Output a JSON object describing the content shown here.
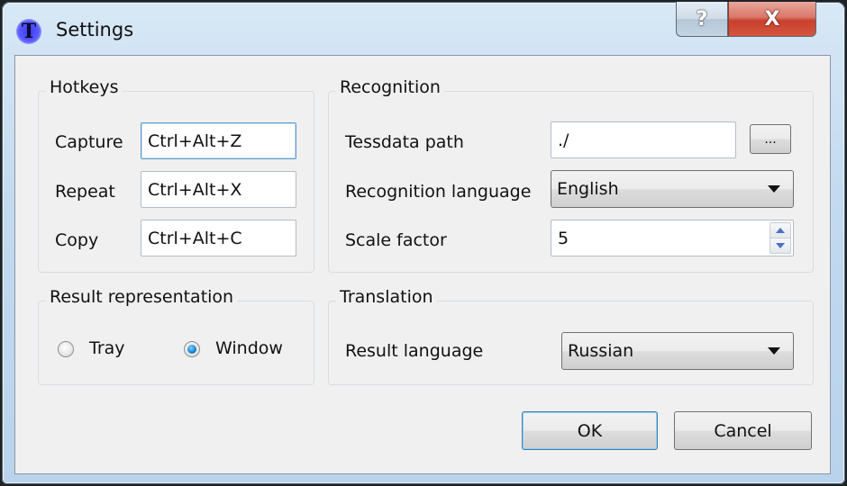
{
  "window": {
    "title": "Settings",
    "app_icon_glyph": "T",
    "help_button_glyph": "?",
    "close_button_glyph": "X"
  },
  "hotkeys": {
    "title": "Hotkeys",
    "rows": [
      {
        "label": "Capture",
        "value": "Ctrl+Alt+Z"
      },
      {
        "label": "Repeat",
        "value": "Ctrl+Alt+X"
      },
      {
        "label": "Copy",
        "value": "Ctrl+Alt+C"
      }
    ]
  },
  "recognition": {
    "title": "Recognition",
    "tessdata_label": "Tessdata path",
    "tessdata_value": "./",
    "browse_label": "...",
    "language_label": "Recognition language",
    "language_value": "English",
    "scale_label": "Scale factor",
    "scale_value": "5"
  },
  "result_representation": {
    "title": "Result representation",
    "options": [
      {
        "label": "Tray",
        "checked": false
      },
      {
        "label": "Window",
        "checked": true
      }
    ]
  },
  "translation": {
    "title": "Translation",
    "language_label": "Result language",
    "language_value": "Russian"
  },
  "buttons": {
    "ok": "OK",
    "cancel": "Cancel"
  }
}
